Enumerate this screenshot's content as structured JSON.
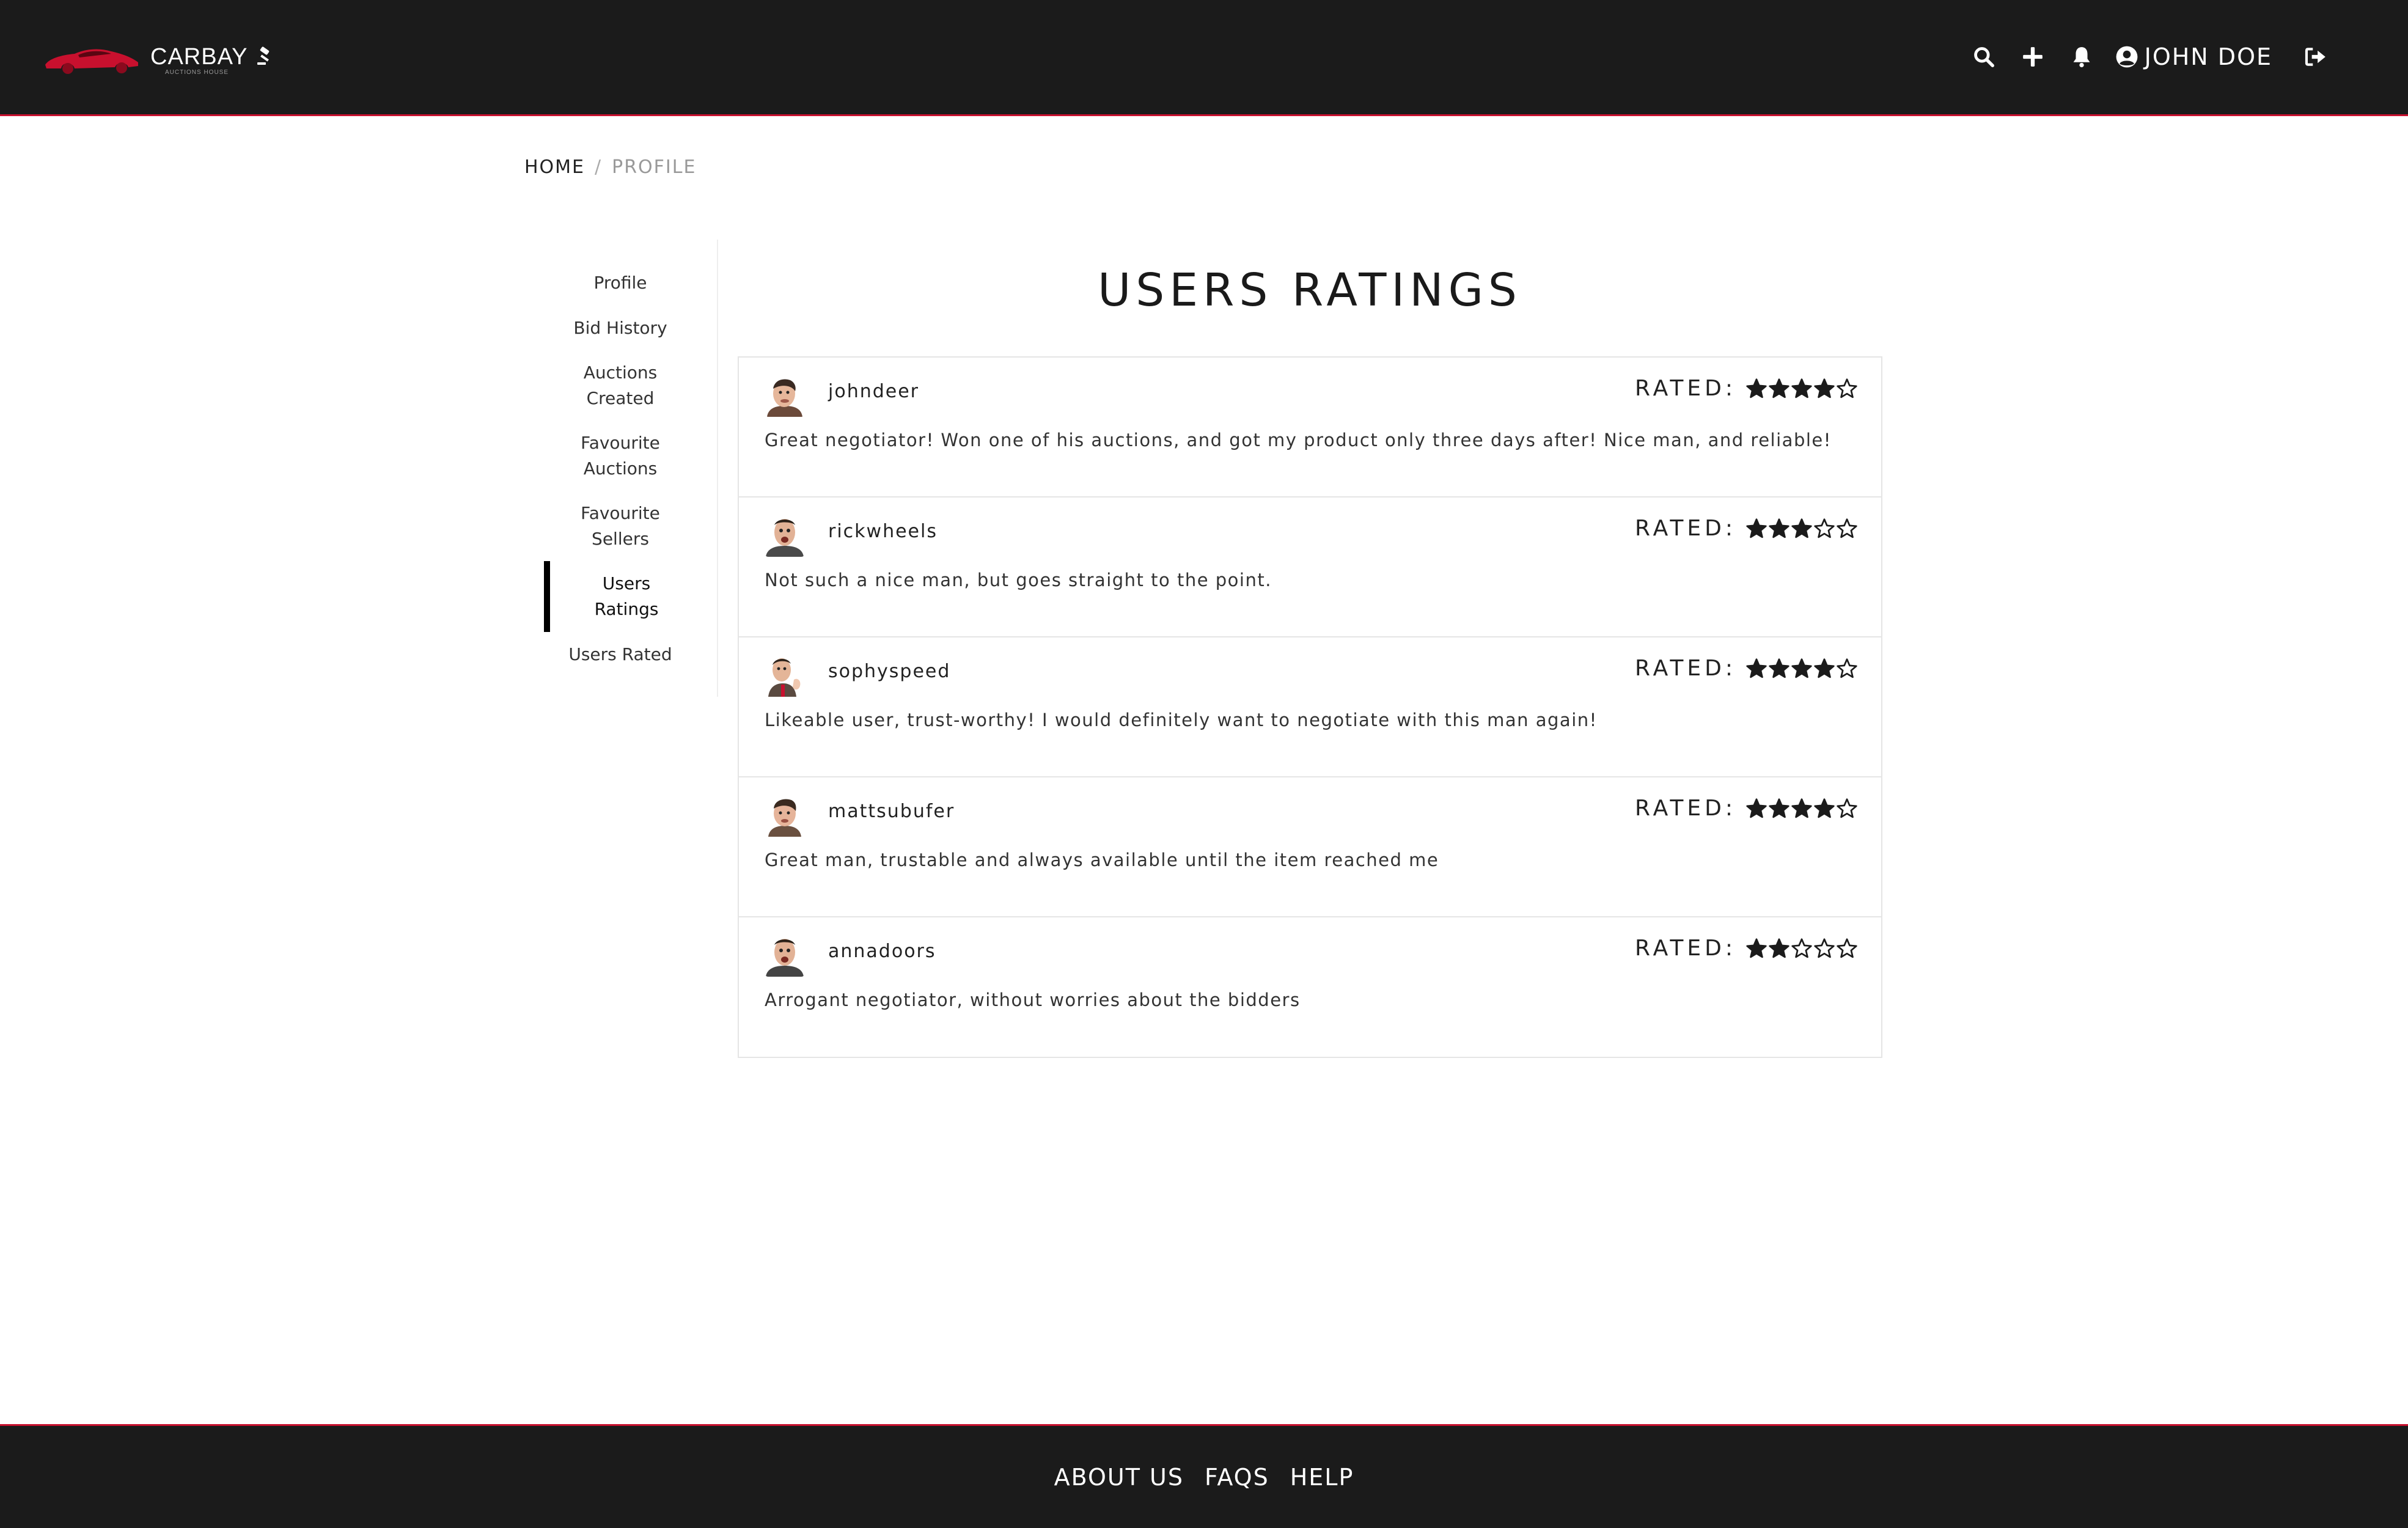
{
  "brand": {
    "name": "CARBAY",
    "subtitle": "AUCTIONS HOUSE",
    "accent_color": "#c8102e"
  },
  "navbar": {
    "icons": [
      "search-icon",
      "plus-icon",
      "bell-icon",
      "user-circle-icon",
      "sign-out-icon"
    ],
    "user_name": "JOHN DOE"
  },
  "breadcrumb": {
    "home": "HOME",
    "separator": "/",
    "current": "PROFILE"
  },
  "sidebar": {
    "items": [
      {
        "label": "Profile",
        "active": false
      },
      {
        "label": "Bid History",
        "active": false
      },
      {
        "label": "Auctions Created",
        "active": false
      },
      {
        "label": "Favourite Auctions",
        "active": false
      },
      {
        "label": "Favourite Sellers",
        "active": false
      },
      {
        "label": "Users Ratings",
        "active": true
      },
      {
        "label": "Users Rated",
        "active": false
      }
    ]
  },
  "main": {
    "title": "USERS RATINGS",
    "rated_label": "RATED:",
    "ratings": [
      {
        "username": "johndeer",
        "stars": 4,
        "max_stars": 5,
        "comment": "Great negotiator! Won one of his auctions, and got my product only three days after! Nice man, and reliable!"
      },
      {
        "username": "rickwheels",
        "stars": 3,
        "max_stars": 5,
        "comment": "Not such a nice man, but goes straight to the point."
      },
      {
        "username": "sophyspeed",
        "stars": 4,
        "max_stars": 5,
        "comment": "Likeable user, trust-worthy! I would definitely want to negotiate with this man again!"
      },
      {
        "username": "mattsubufer",
        "stars": 4,
        "max_stars": 5,
        "comment": "Great man, trustable and always available until the item reached me"
      },
      {
        "username": "annadoors",
        "stars": 2,
        "max_stars": 5,
        "comment": "Arrogant negotiator, without worries about the bidders"
      }
    ]
  },
  "footer": {
    "links": [
      "ABOUT US",
      "FAQS",
      "HELP"
    ]
  }
}
